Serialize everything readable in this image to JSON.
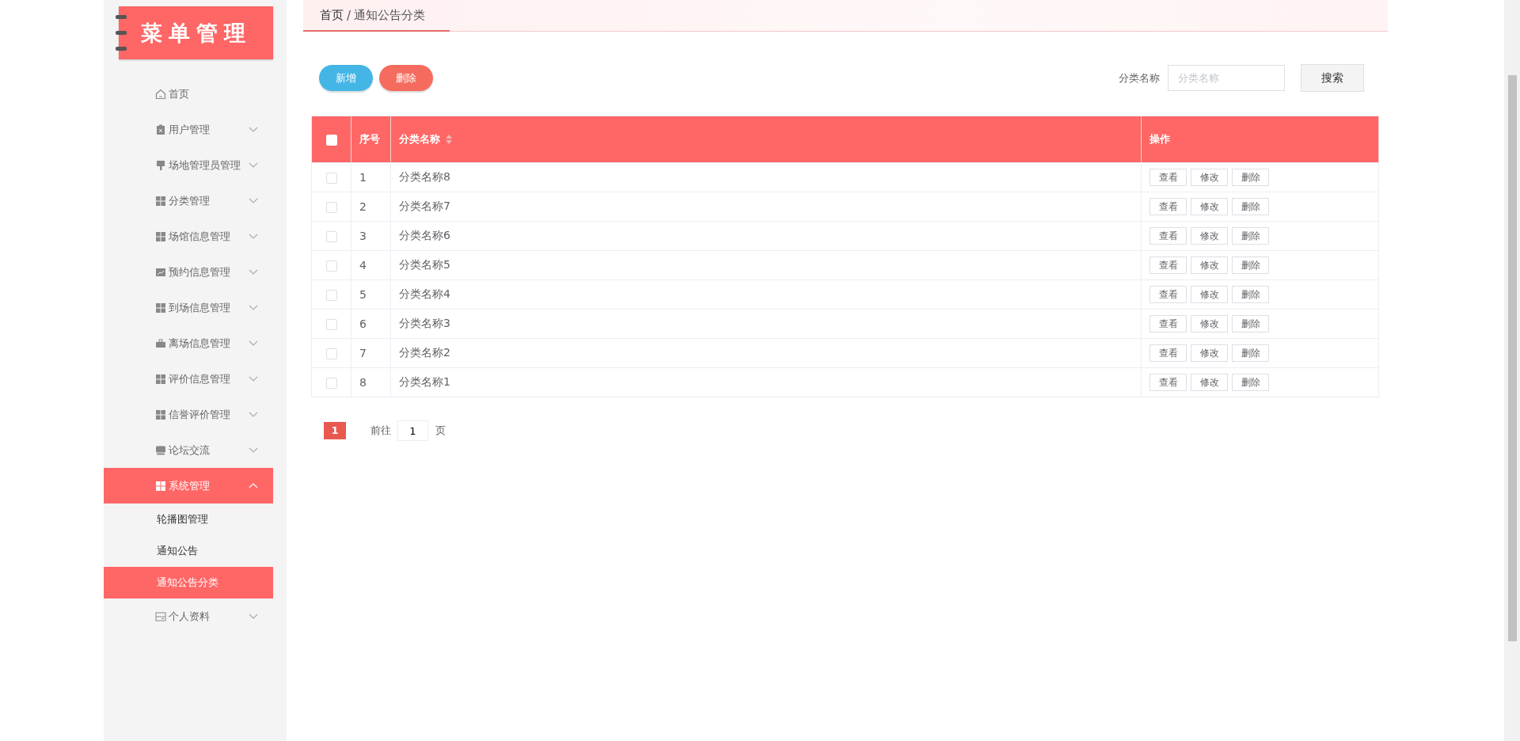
{
  "logo": {
    "title": "菜单管理"
  },
  "menu": [
    {
      "label": "首页",
      "selected": false
    },
    {
      "label": "用户管理",
      "expanded": false,
      "selected": false
    },
    {
      "label": "场地管理员管理",
      "expanded": false,
      "selected": false
    },
    {
      "label": "分类管理",
      "expanded": false,
      "selected": false
    },
    {
      "label": "场馆信息管理",
      "expanded": false,
      "selected": false
    },
    {
      "label": "预约信息管理",
      "expanded": false,
      "selected": false
    },
    {
      "label": "到场信息管理",
      "expanded": false,
      "selected": false
    },
    {
      "label": "离场信息管理",
      "expanded": false,
      "selected": false
    },
    {
      "label": "评价信息管理",
      "expanded": false,
      "selected": false
    },
    {
      "label": "信誉评价管理",
      "expanded": false,
      "selected": false
    },
    {
      "label": "论坛交流",
      "expanded": false,
      "selected": false
    },
    {
      "label": "系统管理",
      "expanded": true,
      "selected": true,
      "children": [
        {
          "label": "轮播图管理",
          "selected": false
        },
        {
          "label": "通知公告",
          "selected": false
        },
        {
          "label": "通知公告分类",
          "selected": true
        }
      ]
    },
    {
      "label": "个人资料",
      "expanded": false,
      "selected": false
    }
  ],
  "breadcrumb": {
    "items": [
      "首页",
      "通知公告分类"
    ],
    "separator": "/"
  },
  "toolbar": {
    "add": "新增",
    "delete": "删除",
    "search_label": "分类名称",
    "search_placeholder": "分类名称",
    "search_button": "搜索"
  },
  "table": {
    "columns": [
      "序号",
      "分类名称",
      "操作"
    ],
    "header_checked": false,
    "rows": [
      {
        "index": "1",
        "name": "分类名称8",
        "checked": false,
        "actions": [
          "查看",
          "修改",
          "删除"
        ]
      },
      {
        "index": "2",
        "name": "分类名称7",
        "checked": false,
        "actions": [
          "查看",
          "修改",
          "删除"
        ]
      },
      {
        "index": "3",
        "name": "分类名称6",
        "checked": false,
        "actions": [
          "查看",
          "修改",
          "删除"
        ]
      },
      {
        "index": "4",
        "name": "分类名称5",
        "checked": false,
        "actions": [
          "查看",
          "修改",
          "删除"
        ]
      },
      {
        "index": "5",
        "name": "分类名称4",
        "checked": false,
        "actions": [
          "查看",
          "修改",
          "删除"
        ]
      },
      {
        "index": "6",
        "name": "分类名称3",
        "checked": false,
        "actions": [
          "查看",
          "修改",
          "删除"
        ]
      },
      {
        "index": "7",
        "name": "分类名称2",
        "checked": false,
        "actions": [
          "查看",
          "修改",
          "删除"
        ]
      },
      {
        "index": "8",
        "name": "分类名称1",
        "checked": false,
        "actions": [
          "查看",
          "修改",
          "删除"
        ]
      }
    ]
  },
  "pagination": {
    "pages": [
      {
        "label": "1",
        "selected": true
      }
    ],
    "goto_label": "前往",
    "goto_value": "1",
    "goto_suffix": "页"
  }
}
